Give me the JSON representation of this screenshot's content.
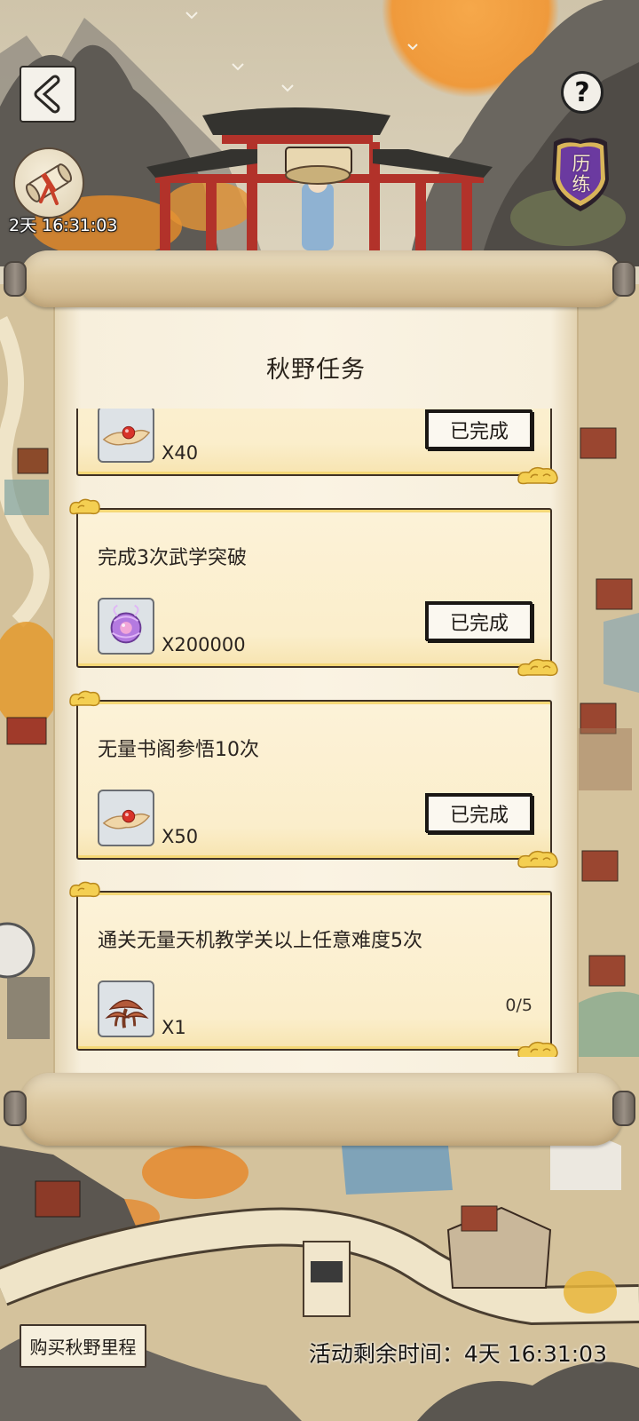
{
  "header": {
    "gift_timer": "2天 16:31:03",
    "help_label": "?",
    "badge_label": "历练"
  },
  "panel": {
    "title": "秋野任务"
  },
  "tasks": [
    {
      "reward_icon": "red-pill-leaf-icon",
      "reward_qty": "X40",
      "status": "已完成"
    },
    {
      "title": "完成3次武学突破",
      "reward_icon": "purple-orb-icon",
      "reward_qty": "X200000",
      "status": "已完成"
    },
    {
      "title": "无量书阁参悟10次",
      "reward_icon": "red-pill-leaf-icon",
      "reward_qty": "X50",
      "status": "已完成"
    },
    {
      "title": "通关无量天机教学关以上任意难度5次",
      "reward_icon": "lingzhi-mushroom-icon",
      "reward_qty": "X1",
      "progress": "0/5"
    }
  ],
  "footer": {
    "buy_button_label": "购买秋野里程",
    "remaining_time": "活动剩余时间：4天 16:31:03"
  },
  "icons": {
    "back": "back-chevron-icon",
    "gift": "gift-scroll-icon",
    "help": "help-icon",
    "badge": "training-badge-icon",
    "card_decoration": "gold-cloud-icon"
  },
  "colors": {
    "card_bg": "#fbf0d3",
    "card_accent": "#f5d877",
    "badge_purple": "#6b3aa0",
    "sun_orange": "#ef9a3c"
  }
}
